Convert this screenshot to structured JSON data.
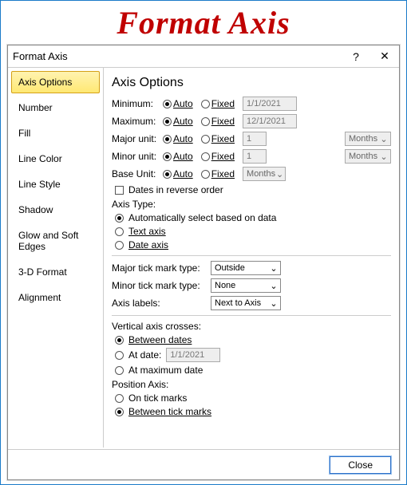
{
  "banner": "Format Axis",
  "dialog": {
    "title": "Format Axis",
    "help": "?",
    "close_x": "✕",
    "close_btn": "Close"
  },
  "sidebar": {
    "items": [
      {
        "label": "Axis Options"
      },
      {
        "label": "Number"
      },
      {
        "label": "Fill"
      },
      {
        "label": "Line Color"
      },
      {
        "label": "Line Style"
      },
      {
        "label": "Shadow"
      },
      {
        "label": "Glow and Soft Edges"
      },
      {
        "label": "3-D Format"
      },
      {
        "label": "Alignment"
      }
    ]
  },
  "panel": {
    "heading": "Axis Options",
    "labels": {
      "minimum": "Minimum:",
      "maximum": "Maximum:",
      "major_unit": "Major unit:",
      "minor_unit": "Minor unit:",
      "base_unit": "Base Unit:",
      "auto": "Auto",
      "fixed": "Fixed",
      "months": "Months",
      "reverse": "Dates in reverse order",
      "axis_type": "Axis Type:",
      "type_auto": "Automatically select based on data",
      "type_text": "Text axis",
      "type_date": "Date axis",
      "major_tick": "Major tick mark type:",
      "minor_tick": "Minor tick mark type:",
      "axis_labels": "Axis labels:",
      "major_tick_v": "Outside",
      "minor_tick_v": "None",
      "axis_labels_v": "Next to Axis",
      "v_cross": "Vertical axis crosses:",
      "between_dates": "Between dates",
      "at_date": "At date:",
      "at_max": "At maximum date",
      "pos_axis": "Position Axis:",
      "on_tick": "On tick marks",
      "between_tick": "Between tick marks"
    },
    "values": {
      "min": "1/1/2021",
      "max": "12/1/2021",
      "major": "1",
      "minor": "1",
      "at_date_v": "1/1/2021"
    }
  }
}
